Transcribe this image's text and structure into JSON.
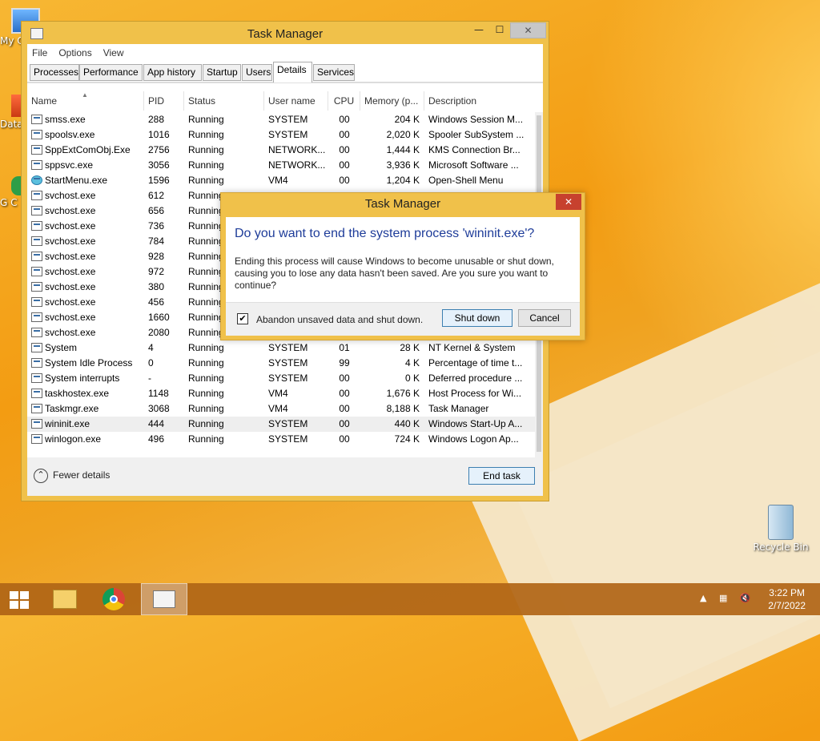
{
  "desktop": {
    "icons": [
      {
        "label": "My C",
        "name": "my-computer-icon"
      },
      {
        "label": "Data",
        "name": "data-shortcut-icon"
      },
      {
        "label": "G C",
        "name": "chrome-shortcut-icon"
      },
      {
        "label": "Recycle Bin",
        "name": "recycle-bin-icon"
      }
    ]
  },
  "window": {
    "title": "Task Manager",
    "menu": [
      "File",
      "Options",
      "View"
    ],
    "tabs": [
      "Processes",
      "Performance",
      "App history",
      "Startup",
      "Users",
      "Details",
      "Services"
    ],
    "active_tab": "Details",
    "columns": [
      "Name",
      "PID",
      "Status",
      "User name",
      "CPU",
      "Memory (p...",
      "Description"
    ],
    "rows": [
      {
        "name": "smss.exe",
        "pid": "288",
        "status": "Running",
        "user": "SYSTEM",
        "cpu": "00",
        "mem": "204 K",
        "desc": "Windows Session M..."
      },
      {
        "name": "spoolsv.exe",
        "pid": "1016",
        "status": "Running",
        "user": "SYSTEM",
        "cpu": "00",
        "mem": "2,020 K",
        "desc": "Spooler SubSystem ..."
      },
      {
        "name": "SppExtComObj.Exe",
        "pid": "2756",
        "status": "Running",
        "user": "NETWORK...",
        "cpu": "00",
        "mem": "1,444 K",
        "desc": "KMS Connection Br..."
      },
      {
        "name": "sppsvc.exe",
        "pid": "3056",
        "status": "Running",
        "user": "NETWORK...",
        "cpu": "00",
        "mem": "3,936 K",
        "desc": "Microsoft Software ..."
      },
      {
        "name": "StartMenu.exe",
        "pid": "1596",
        "status": "Running",
        "user": "VM4",
        "cpu": "00",
        "mem": "1,204 K",
        "desc": "Open-Shell Menu"
      },
      {
        "name": "svchost.exe",
        "pid": "612",
        "status": "Running",
        "user": "",
        "cpu": "",
        "mem": "",
        "desc": ""
      },
      {
        "name": "svchost.exe",
        "pid": "656",
        "status": "Running",
        "user": "",
        "cpu": "",
        "mem": "",
        "desc": ""
      },
      {
        "name": "svchost.exe",
        "pid": "736",
        "status": "Running",
        "user": "",
        "cpu": "",
        "mem": "",
        "desc": ""
      },
      {
        "name": "svchost.exe",
        "pid": "784",
        "status": "Running",
        "user": "",
        "cpu": "",
        "mem": "",
        "desc": ""
      },
      {
        "name": "svchost.exe",
        "pid": "928",
        "status": "Running",
        "user": "",
        "cpu": "",
        "mem": "",
        "desc": ""
      },
      {
        "name": "svchost.exe",
        "pid": "972",
        "status": "Running",
        "user": "",
        "cpu": "",
        "mem": "",
        "desc": ""
      },
      {
        "name": "svchost.exe",
        "pid": "380",
        "status": "Running",
        "user": "",
        "cpu": "",
        "mem": "",
        "desc": ""
      },
      {
        "name": "svchost.exe",
        "pid": "456",
        "status": "Running",
        "user": "",
        "cpu": "",
        "mem": "",
        "desc": ""
      },
      {
        "name": "svchost.exe",
        "pid": "1660",
        "status": "Running",
        "user": "",
        "cpu": "",
        "mem": "",
        "desc": ""
      },
      {
        "name": "svchost.exe",
        "pid": "2080",
        "status": "Running",
        "user": "",
        "cpu": "",
        "mem": "",
        "desc": ""
      },
      {
        "name": "System",
        "pid": "4",
        "status": "Running",
        "user": "SYSTEM",
        "cpu": "01",
        "mem": "28 K",
        "desc": "NT Kernel & System"
      },
      {
        "name": "System Idle Process",
        "pid": "0",
        "status": "Running",
        "user": "SYSTEM",
        "cpu": "99",
        "mem": "4 K",
        "desc": "Percentage of time t..."
      },
      {
        "name": "System interrupts",
        "pid": "-",
        "status": "Running",
        "user": "SYSTEM",
        "cpu": "00",
        "mem": "0 K",
        "desc": "Deferred procedure ..."
      },
      {
        "name": "taskhostex.exe",
        "pid": "1148",
        "status": "Running",
        "user": "VM4",
        "cpu": "00",
        "mem": "1,676 K",
        "desc": "Host Process for Wi..."
      },
      {
        "name": "Taskmgr.exe",
        "pid": "3068",
        "status": "Running",
        "user": "VM4",
        "cpu": "00",
        "mem": "8,188 K",
        "desc": "Task Manager"
      },
      {
        "name": "wininit.exe",
        "pid": "444",
        "status": "Running",
        "user": "SYSTEM",
        "cpu": "00",
        "mem": "440 K",
        "desc": "Windows Start-Up A..."
      },
      {
        "name": "winlogon.exe",
        "pid": "496",
        "status": "Running",
        "user": "SYSTEM",
        "cpu": "00",
        "mem": "724 K",
        "desc": "Windows Logon Ap..."
      }
    ],
    "selected_row": "wininit.exe",
    "fewer_details": "Fewer details",
    "end_task": "End task"
  },
  "dialog": {
    "title": "Task Manager",
    "close": "✕",
    "heading": "Do you want to end the system process 'wininit.exe'?",
    "body": "Ending this process will cause Windows to become unusable or shut down, causing you to lose any data hasn't been saved. Are you sure you want to continue?",
    "checkbox_label": "Abandon unsaved data and shut down.",
    "checkbox_checked": true,
    "shutdown_button": "Shut down",
    "cancel_button": "Cancel"
  },
  "taskbar": {
    "time": "3:22 PM",
    "date": "2/7/2022",
    "tray_icons": [
      "show-hidden-icons-icon",
      "network-icon",
      "volume-muted-icon"
    ]
  }
}
